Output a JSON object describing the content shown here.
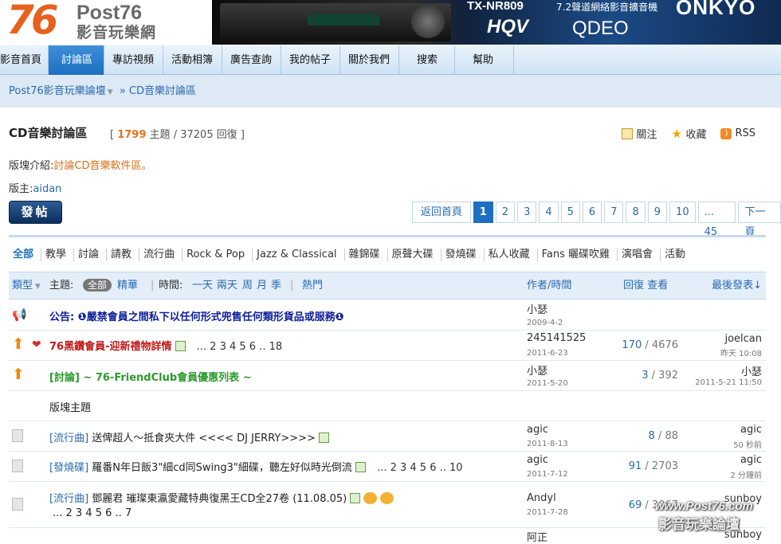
{
  "header": {
    "logo_number": "76",
    "logo_brand": "Post76",
    "logo_sub": "影音玩樂網",
    "banner": {
      "model": "TX-NR809",
      "desc": "7.2聲道網絡影音擴音機",
      "hqv": "HQV",
      "qdeo": "QDEO",
      "brand": "ONKYO"
    }
  },
  "nav": [
    "影音首頁",
    "討論區",
    "專訪視頻",
    "活動相簿",
    "廣告查詢",
    "我的帖子",
    "關於我們",
    "搜索",
    "幫助"
  ],
  "breadcrumb": {
    "home": "Post76影音玩樂論壇",
    "current": "» CD音樂討論區"
  },
  "forum": {
    "title": "CD音樂討論區",
    "stats_open": "[",
    "topics": "1799",
    "topics_label": "主題",
    "sep": "/",
    "replies": "37205",
    "replies_label": "回復",
    "stats_close": "]",
    "actions": [
      "關注",
      "收藏",
      "RSS"
    ],
    "intro_label": "版塊介紹:",
    "intro_value": "討論CD音樂軟件區。",
    "mod_label": "版主:",
    "mod_value": "aidan",
    "post_button": "發帖"
  },
  "pager": {
    "back": "返回首頁",
    "pages": [
      "1",
      "2",
      "3",
      "4",
      "5",
      "6",
      "7",
      "8",
      "9",
      "10"
    ],
    "current": "1",
    "last": "... 45",
    "next": "下一頁"
  },
  "type_tabs": [
    "全部",
    "教學",
    "討論",
    "請教",
    "流行曲",
    "Rock & Pop",
    "Jazz & Classical",
    "雜錦碟",
    "原聲大碟",
    "發燒碟",
    "私人收藏",
    "Fans 曬碟吹雞",
    "演唱會",
    "活動"
  ],
  "thread_header": {
    "type": "類型",
    "topic": "主題:",
    "all": "全部",
    "digest": "精華",
    "time": "時間:",
    "periods": [
      "一天",
      "兩天",
      "周",
      "月",
      "季"
    ],
    "hot": "熱門",
    "author_time": "作者/時間",
    "reply_view": "回復 查看",
    "last_post": "最後發表"
  },
  "threads": [
    {
      "kind": "announce",
      "subject": "公告: ❶嚴禁會員之間私下以任何形式兜售任何類形貨品或服務❶",
      "author": "小瑟",
      "date": "2009-4-2"
    },
    {
      "kind": "sticky-red",
      "subject": "76黑鑽會員-迎新禮物詳情",
      "pages": "... 2 3 4 5 6 .. 18",
      "author": "245141525",
      "date": "2011-6-23",
      "replies": "170",
      "views": "4676",
      "last_user": "joelcan",
      "last_time": "昨天 10:08"
    },
    {
      "kind": "sticky-green",
      "subject": "[討論] ~ 76-FriendClub會員優惠列表 ~",
      "author": "小瑟",
      "date": "2011-5-20",
      "replies": "3",
      "views": "392",
      "last_user": "小瑟",
      "last_time": "2011-5-21 11:50"
    },
    {
      "kind": "section",
      "subject": "版塊主題"
    },
    {
      "kind": "normal",
      "category": "[流行曲]",
      "subject": "送俾超人～抵食夾大件 <<<< DJ JERRY>>>>",
      "author": "agic",
      "date": "2011-8-13",
      "replies": "8",
      "views": "88",
      "last_user": "agic",
      "last_time": "50 秒前"
    },
    {
      "kind": "normal",
      "category": "[發燒碟]",
      "subject": "羅番N年日飯3\"細cd同Swing3\"細碟，聽左好似時光倒流",
      "pages": "... 2 3 4 5 6 .. 10",
      "author": "agic",
      "date": "2011-7-12",
      "replies": "91",
      "views": "2703",
      "last_user": "agic",
      "last_time": "2 分鐘前"
    },
    {
      "kind": "normal2",
      "category": "[流行曲]",
      "subject": "鄧麗君 璀璨東瀛愛藏特典復黑王CD全27卷 (11.08.05)",
      "pages": "... 2 3 4 5 6 .. 7",
      "author": "Andyl",
      "date": "2011-7-28",
      "replies": "69",
      "views": "3067",
      "last_user": "sunboy",
      "last_time": ""
    },
    {
      "kind": "partial",
      "author": "阿正",
      "last_user": "sunboy"
    }
  ],
  "watermark": {
    "url": "www.Post76.com",
    "name": "影音玩樂論壇"
  }
}
